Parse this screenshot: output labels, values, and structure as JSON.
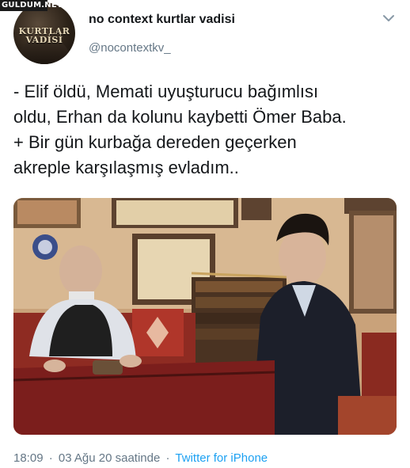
{
  "watermark": {
    "text": "GULDUM.NET"
  },
  "profile": {
    "avatar_text_line1": "KURTLAR",
    "avatar_text_line2": "VADİSİ",
    "display_name": "no context kurtlar vadisi",
    "handle": "@nocontextkv_",
    "menu_icon": "chevron-down-icon"
  },
  "tweet": {
    "lines": [
      "- Elif öldü, Memati uyuşturucu bağımlısı",
      "oldu, Erhan da kolunu kaybetti Ömer Baba.",
      "+ Bir gün kurbağa dereden geçerken",
      "akreple karşılaşmış evladım.."
    ]
  },
  "meta": {
    "time": "18:09",
    "separator": "·",
    "date": "03 Ağu 20 saatinde",
    "source": "Twitter for iPhone"
  },
  "colors": {
    "text_primary": "#14171a",
    "text_secondary": "#657786",
    "link": "#1da1f2"
  }
}
